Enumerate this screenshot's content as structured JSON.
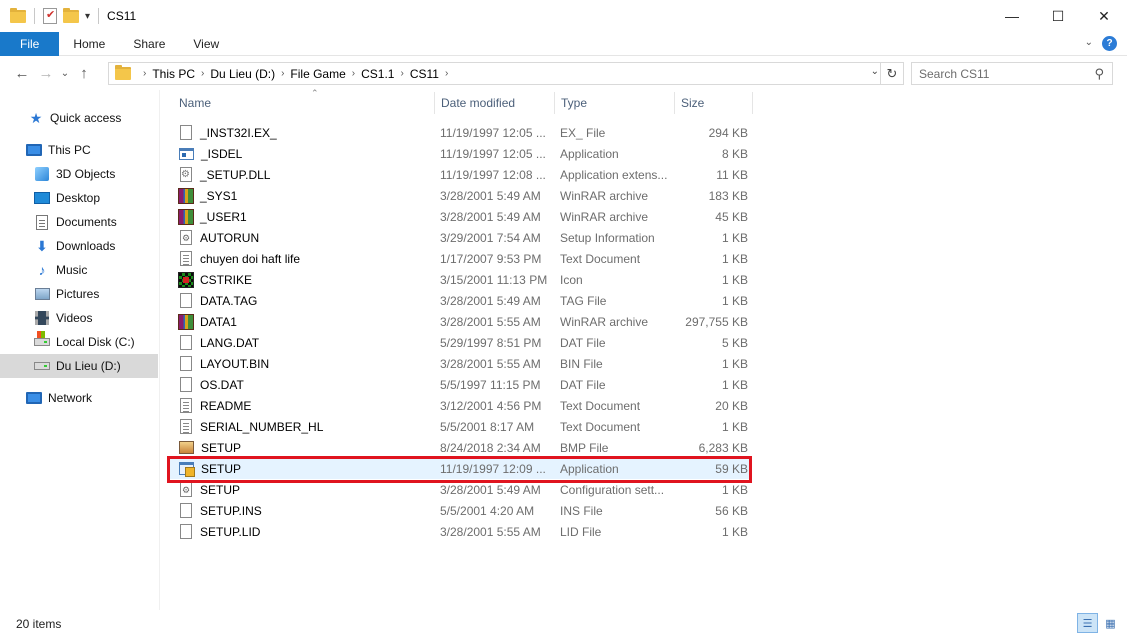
{
  "window": {
    "title": "CS11",
    "minimize": "—",
    "maximize": "☐",
    "close": "✕"
  },
  "ribbon": {
    "tabs": [
      "File",
      "Home",
      "Share",
      "View"
    ],
    "expand": "⌄",
    "help": "?"
  },
  "nav": {
    "back": "←",
    "forward": "→",
    "recent": "⌄",
    "up": "↑",
    "breadcrumb": [
      "This PC",
      "Du Lieu (D:)",
      "File Game",
      "CS1.1",
      "CS11"
    ],
    "refresh": "↻",
    "search_placeholder": "Search CS11"
  },
  "sidebar": {
    "items": [
      {
        "label": "Quick access",
        "icon": "star-icon"
      },
      {
        "label": "This PC",
        "icon": "computer-icon"
      },
      {
        "label": "3D Objects",
        "icon": "3d-objects-icon"
      },
      {
        "label": "Desktop",
        "icon": "desktop-icon"
      },
      {
        "label": "Documents",
        "icon": "documents-icon"
      },
      {
        "label": "Downloads",
        "icon": "downloads-icon"
      },
      {
        "label": "Music",
        "icon": "music-icon"
      },
      {
        "label": "Pictures",
        "icon": "pictures-icon"
      },
      {
        "label": "Videos",
        "icon": "videos-icon"
      },
      {
        "label": "Local Disk (C:)",
        "icon": "system-disk-icon"
      },
      {
        "label": "Du Lieu (D:)",
        "icon": "disk-icon",
        "selected": true
      },
      {
        "label": "Network",
        "icon": "network-icon"
      }
    ]
  },
  "columns": {
    "name": "Name",
    "date": "Date modified",
    "type": "Type",
    "size": "Size"
  },
  "files": [
    {
      "name": "_INST32I.EX_",
      "date": "11/19/1997 12:05 ...",
      "type": "EX_ File",
      "size": "294 KB",
      "icon": "blank"
    },
    {
      "name": "_ISDEL",
      "date": "11/19/1997 12:05 ...",
      "type": "Application",
      "size": "8 KB",
      "icon": "app"
    },
    {
      "name": "_SETUP.DLL",
      "date": "11/19/1997 12:08 ...",
      "type": "Application extens...",
      "size": "11 KB",
      "icon": "dll"
    },
    {
      "name": "_SYS1",
      "date": "3/28/2001 5:49 AM",
      "type": "WinRAR archive",
      "size": "183 KB",
      "icon": "rar"
    },
    {
      "name": "_USER1",
      "date": "3/28/2001 5:49 AM",
      "type": "WinRAR archive",
      "size": "45 KB",
      "icon": "rar"
    },
    {
      "name": "AUTORUN",
      "date": "3/29/2001 7:54 AM",
      "type": "Setup Information",
      "size": "1 KB",
      "icon": "setinfo"
    },
    {
      "name": "chuyen doi haft life",
      "date": "1/17/2007 9:53 PM",
      "type": "Text Document",
      "size": "1 KB",
      "icon": "text"
    },
    {
      "name": "CSTRIKE",
      "date": "3/15/2001 11:13 PM",
      "type": "Icon",
      "size": "1 KB",
      "icon": "cstrike"
    },
    {
      "name": "DATA.TAG",
      "date": "3/28/2001 5:49 AM",
      "type": "TAG File",
      "size": "1 KB",
      "icon": "blank"
    },
    {
      "name": "DATA1",
      "date": "3/28/2001 5:55 AM",
      "type": "WinRAR archive",
      "size": "297,755 KB",
      "icon": "rar"
    },
    {
      "name": "LANG.DAT",
      "date": "5/29/1997 8:51 PM",
      "type": "DAT File",
      "size": "5 KB",
      "icon": "blank"
    },
    {
      "name": "LAYOUT.BIN",
      "date": "3/28/2001 5:55 AM",
      "type": "BIN File",
      "size": "1 KB",
      "icon": "blank"
    },
    {
      "name": "OS.DAT",
      "date": "5/5/1997 11:15 PM",
      "type": "DAT File",
      "size": "1 KB",
      "icon": "blank"
    },
    {
      "name": "README",
      "date": "3/12/2001 4:56 PM",
      "type": "Text Document",
      "size": "20 KB",
      "icon": "text"
    },
    {
      "name": "SERIAL_NUMBER_HL",
      "date": "5/5/2001 8:17 AM",
      "type": "Text Document",
      "size": "1 KB",
      "icon": "text"
    },
    {
      "name": "SETUP",
      "date": "8/24/2018 2:34 AM",
      "type": "BMP File",
      "size": "6,283 KB",
      "icon": "bmp"
    },
    {
      "name": "SETUP",
      "date": "11/19/1997 12:09 ...",
      "type": "Application",
      "size": "59 KB",
      "icon": "setupapp",
      "selected": true
    },
    {
      "name": "SETUP",
      "date": "3/28/2001 5:49 AM",
      "type": "Configuration sett...",
      "size": "1 KB",
      "icon": "setinfo"
    },
    {
      "name": "SETUP.INS",
      "date": "5/5/2001 4:20 AM",
      "type": "INS File",
      "size": "56 KB",
      "icon": "blank"
    },
    {
      "name": "SETUP.LID",
      "date": "3/28/2001 5:55 AM",
      "type": "LID File",
      "size": "1 KB",
      "icon": "blank"
    }
  ],
  "status": {
    "item_count": "20 items"
  }
}
